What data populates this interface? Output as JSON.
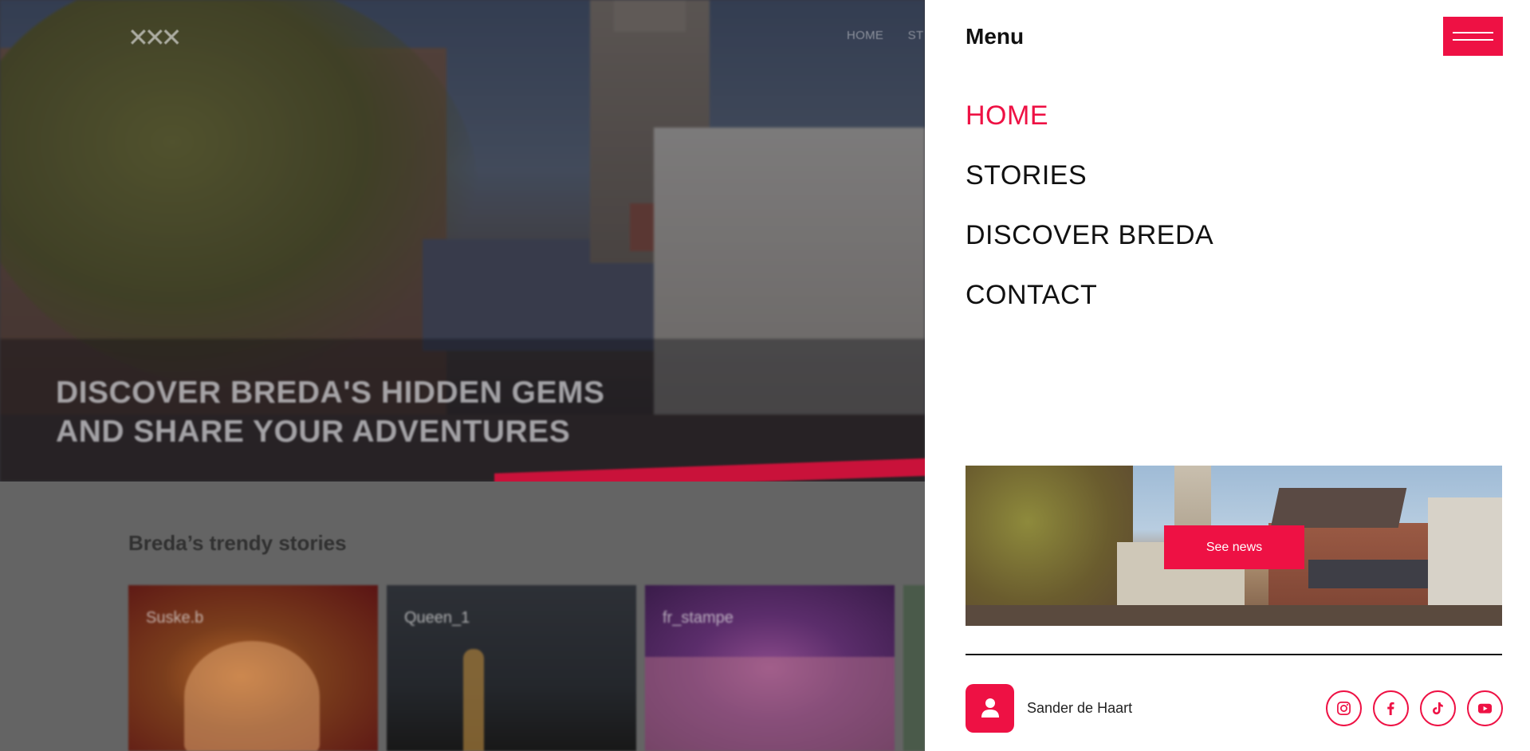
{
  "background_page": {
    "logo_text": "✕✕✕",
    "nav_items": [
      "HOME",
      "ST"
    ],
    "hero_title_line1": "DISCOVER BREDA'S HIDDEN GEMS",
    "hero_title_line2": "AND SHARE YOUR ADVENTURES",
    "stories_heading": "Breda’s trendy stories",
    "story_cards": [
      {
        "label": "Suske.b"
      },
      {
        "label": "Queen_1"
      },
      {
        "label": "fr_stampe"
      },
      {
        "label": ""
      }
    ]
  },
  "menu": {
    "title": "Menu",
    "nav_items": [
      {
        "label": "HOME",
        "active": true
      },
      {
        "label": "STORIES",
        "active": false
      },
      {
        "label": "DISCOVER BREDA",
        "active": false
      },
      {
        "label": "CONTACT",
        "active": false
      }
    ],
    "promo_button_label": "See news",
    "user": {
      "name": "Sander de Haart",
      "icon": "user-icon"
    },
    "socials": [
      {
        "icon": "instagram-icon"
      },
      {
        "icon": "facebook-icon"
      },
      {
        "icon": "tiktok-icon"
      },
      {
        "icon": "youtube-icon"
      }
    ]
  },
  "colors": {
    "accent": "#ee1144",
    "text": "#111111",
    "panel_background": "#ffffff",
    "overlay": "#5a5a5a"
  }
}
